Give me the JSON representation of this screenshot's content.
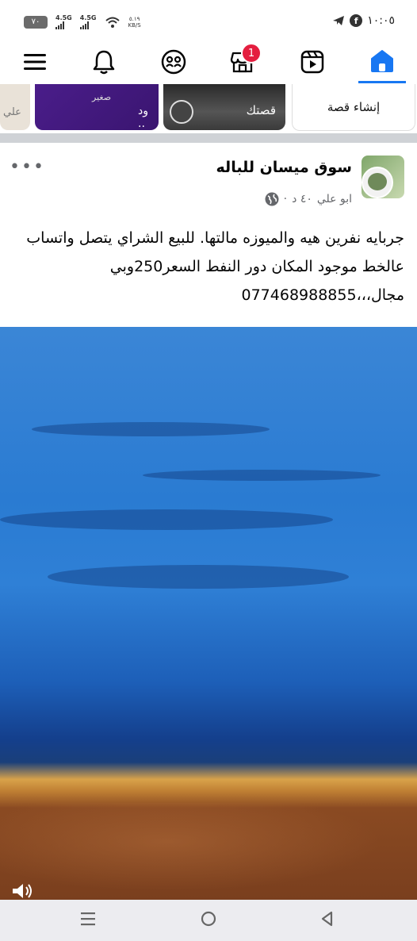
{
  "status_bar": {
    "time": "١٠:٠٥",
    "battery": "٧٠",
    "signal1": "4.5G",
    "signal2": "4.5G",
    "speed_value": "٥.١٩",
    "speed_unit": "KB/S"
  },
  "top_nav": {
    "items": [
      "home-icon",
      "video-icon",
      "marketplace-icon",
      "friends-icon",
      "notifications-icon",
      "menu-icon"
    ],
    "marketplace_badge": "1",
    "active": "home",
    "accent": "#1877f2"
  },
  "stories": {
    "create_label": "إنشاء قصة",
    "your_story_label": "قصتك",
    "purple_story_line1": "صغير",
    "purple_story_line2": "ود ..",
    "edge_story_label": "علي"
  },
  "post": {
    "group_name": "سوق ميسان للباله",
    "author": "ابو علي",
    "time": "٤٠ د",
    "text": "جربايه نفرين هيه والميوزه مالتها. للبيع الشراي يتصل واتساب عالخط موجود المكان دور النفط السعر250وبي مجال،،،077468988855"
  },
  "colors": {
    "separator": "#cfd2d6",
    "badge": "#e41e3f",
    "meta_text": "#65676b"
  }
}
